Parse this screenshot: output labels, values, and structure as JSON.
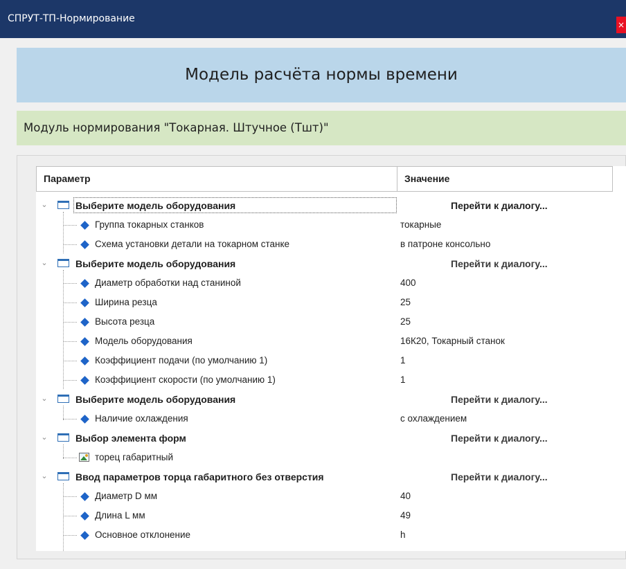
{
  "window": {
    "title": "СПРУТ-ТП-Нормирование",
    "close_label": "×"
  },
  "header": {
    "title": "Модель расчёта нормы времени"
  },
  "module": {
    "label": "Модуль нормирования \"Токарная. Штучное (Тшт)\""
  },
  "table": {
    "columns": {
      "param": "Параметр",
      "value": "Значение"
    },
    "rows": [
      {
        "label": "Выберите модель оборудования",
        "value": "Перейти к диалогу..."
      },
      {
        "label": "Группа токарных станков",
        "value": "токарные"
      },
      {
        "label": "Схема установки детали на токарном станке",
        "value": "в патроне консольно"
      },
      {
        "label": "Выберите модель оборудования",
        "value": "Перейти к диалогу..."
      },
      {
        "label": "Диаметр обработки над станиной",
        "value": "400"
      },
      {
        "label": "Ширина резца",
        "value": "25"
      },
      {
        "label": "Высота резца",
        "value": "25"
      },
      {
        "label": "Модель оборудования",
        "value": "16К20, Токарный станок"
      },
      {
        "label": "Коэффициент подачи (по умолчанию 1)",
        "value": "1"
      },
      {
        "label": "Коэффициент скорости (по умолчанию 1)",
        "value": "1"
      },
      {
        "label": "Выберите модель оборудования",
        "value": "Перейти к диалогу..."
      },
      {
        "label": "Наличие охлаждения",
        "value": "с охлаждением"
      },
      {
        "label": "Выбор элемента форм",
        "value": "Перейти к диалогу..."
      },
      {
        "label": "торец габаритный",
        "value": ""
      },
      {
        "label": "Ввод параметров торца габаритного без отверстия",
        "value": "Перейти к диалогу..."
      },
      {
        "label": "Диаметр D мм",
        "value": "40"
      },
      {
        "label": "Длина L мм",
        "value": "49"
      },
      {
        "label": "Основное отклонение",
        "value": "h"
      }
    ]
  },
  "icons": {
    "group": "group-box-icon",
    "param": "diamond-icon",
    "image": "image-icon",
    "expand": "chevron-down-icon"
  },
  "colors": {
    "titlebar": "#1c3768",
    "header_panel": "#bad6ea",
    "module_panel": "#d6e7c4",
    "diamond": "#1e64c8"
  }
}
